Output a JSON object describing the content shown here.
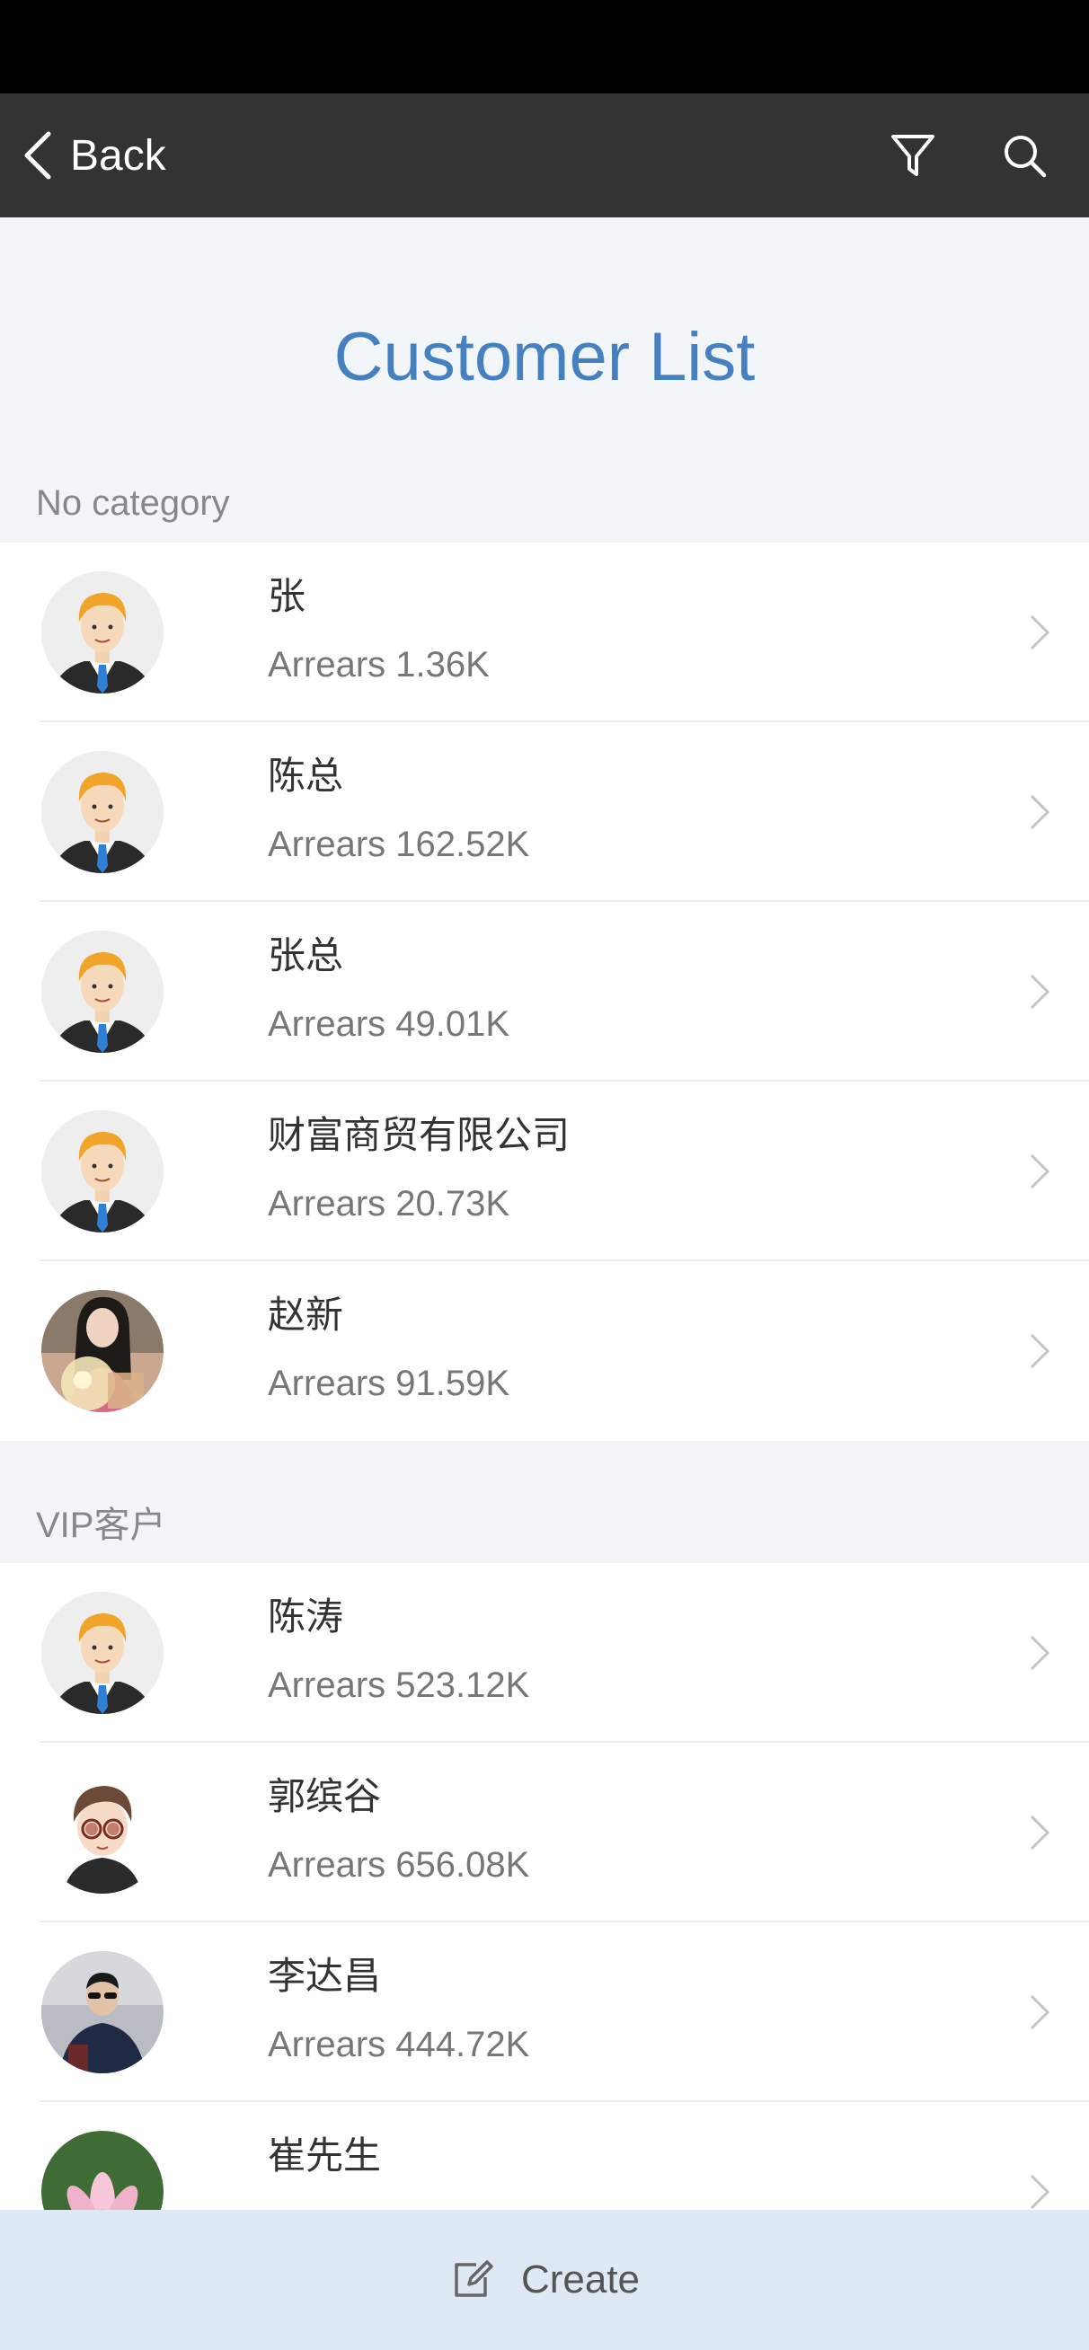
{
  "nav": {
    "back_label": "Back",
    "filter_icon": "filter-icon",
    "search_icon": "search-icon"
  },
  "page": {
    "title": "Customer List"
  },
  "sections": [
    {
      "header": "No category",
      "customers": [
        {
          "name": "张",
          "arrears": "Arrears 1.36K",
          "avatar": "default-man-avatar"
        },
        {
          "name": "陈总",
          "arrears": "Arrears 162.52K",
          "avatar": "default-man-avatar"
        },
        {
          "name": "张总",
          "arrears": "Arrears 49.01K",
          "avatar": "default-man-avatar"
        },
        {
          "name": "财富商贸有限公司",
          "arrears": "Arrears 20.73K",
          "avatar": "default-man-avatar"
        },
        {
          "name": "赵新",
          "arrears": "Arrears 91.59K",
          "avatar": "woman-photo-avatar"
        }
      ]
    },
    {
      "header": "VIP客户",
      "customers": [
        {
          "name": "陈涛",
          "arrears": "Arrears 523.12K",
          "avatar": "default-man-avatar"
        },
        {
          "name": "郭缤谷",
          "arrears": "Arrears 656.08K",
          "avatar": "cartoon-man-avatar"
        },
        {
          "name": "李达昌",
          "arrears": "Arrears 444.72K",
          "avatar": "man-photo-avatar"
        },
        {
          "name": "崔先生",
          "arrears": "",
          "avatar": "lotus-flower-avatar"
        }
      ]
    }
  ],
  "bottom_bar": {
    "create_label": "Create",
    "create_icon": "edit-icon"
  },
  "colors": {
    "nav_background": "#333333",
    "title_blue": "#4580c0",
    "page_background": "#f3f6f9",
    "bottom_bar_background": "#dfe9f5"
  }
}
